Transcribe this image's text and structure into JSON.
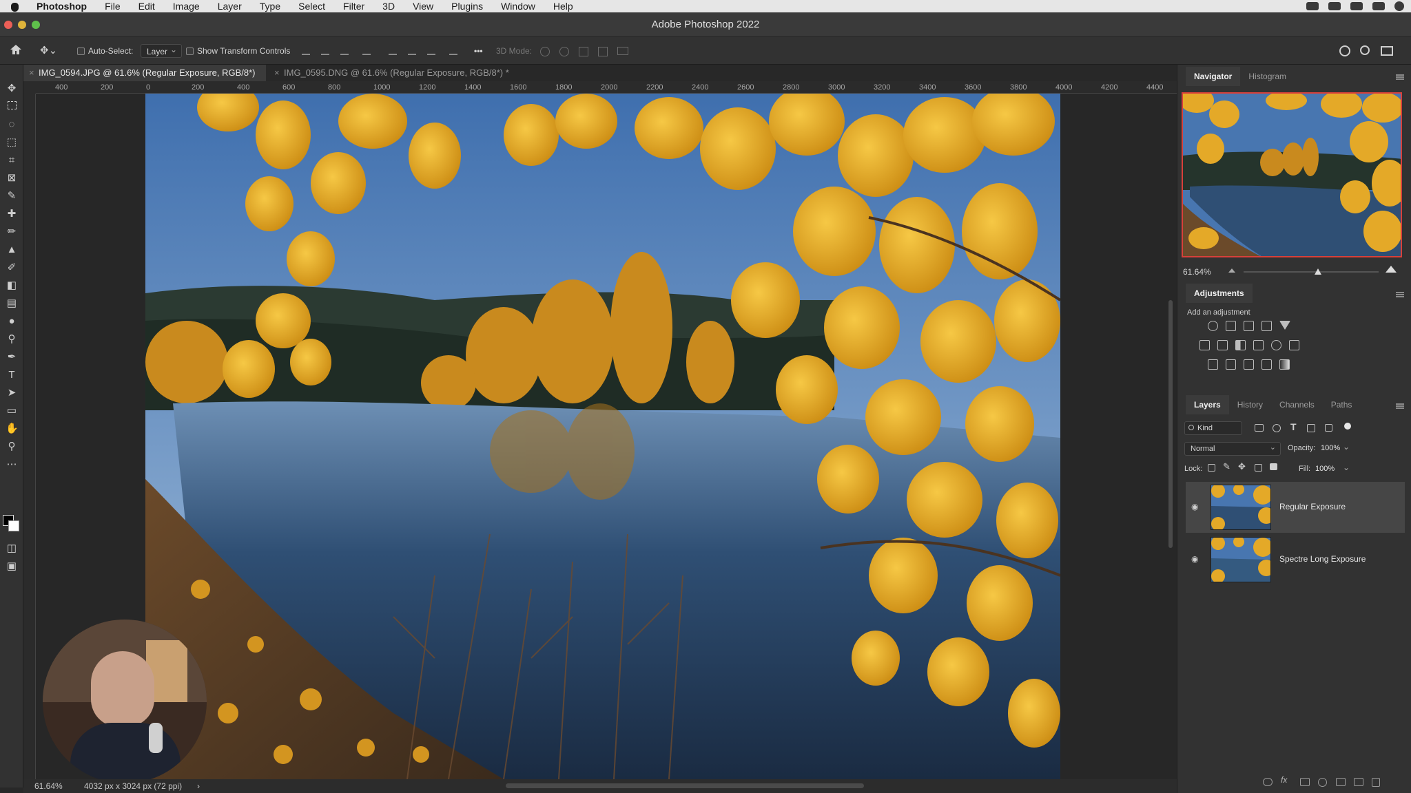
{
  "menubar": {
    "apple": "",
    "app": "Photoshop",
    "items": [
      "File",
      "Edit",
      "Image",
      "Layer",
      "Type",
      "Select",
      "Filter",
      "3D",
      "View",
      "Plugins",
      "Window",
      "Help"
    ]
  },
  "window": {
    "title": "Adobe Photoshop 2022"
  },
  "options": {
    "auto_select_label": "Auto-Select:",
    "auto_select_value": "Layer",
    "show_transform_label": "Show Transform Controls",
    "mode_3d_label": "3D Mode:",
    "more": "•••"
  },
  "tabs": [
    {
      "label": "IMG_0594.JPG @ 61.6% (Regular Exposure, RGB/8*) *",
      "close": "×"
    },
    {
      "label": "IMG_0595.DNG @ 61.6% (Regular Exposure, RGB/8*) *",
      "close": "×"
    }
  ],
  "ruler": {
    "ticks": [
      "400",
      "200",
      "0",
      "200",
      "400",
      "600",
      "800",
      "1000",
      "1200",
      "1400",
      "1600",
      "1800",
      "2000",
      "2200",
      "2400",
      "2600",
      "2800",
      "3000",
      "3200",
      "3400",
      "3600",
      "3800",
      "4000",
      "4200",
      "4400"
    ]
  },
  "status": {
    "zoom": "61.64%",
    "doc": "4032 px x 3024 px (72 ppi)",
    "arrow": "›"
  },
  "navigator": {
    "tabs": [
      "Navigator",
      "Histogram"
    ],
    "zoom": "61.64%",
    "zoom_level": 0.55
  },
  "adjustments": {
    "title": "Adjustments",
    "subtitle": "Add an adjustment"
  },
  "layers_panel": {
    "tabs": [
      "Layers",
      "History",
      "Channels",
      "Paths"
    ],
    "filter_label": "Kind",
    "blend_mode": "Normal",
    "opacity_label": "Opacity:",
    "opacity_value": "100%",
    "lock_label": "Lock:",
    "fill_label": "Fill:",
    "fill_value": "100%",
    "layers": [
      {
        "name": "Regular Exposure",
        "selected": true
      },
      {
        "name": "Spectre Long Exposure",
        "selected": false
      }
    ]
  },
  "colors": {
    "accent": "#d8403a",
    "panel": "#323232",
    "canvas": "#272727",
    "sky": "#4f7fb8",
    "leaf": "#e0a020"
  }
}
